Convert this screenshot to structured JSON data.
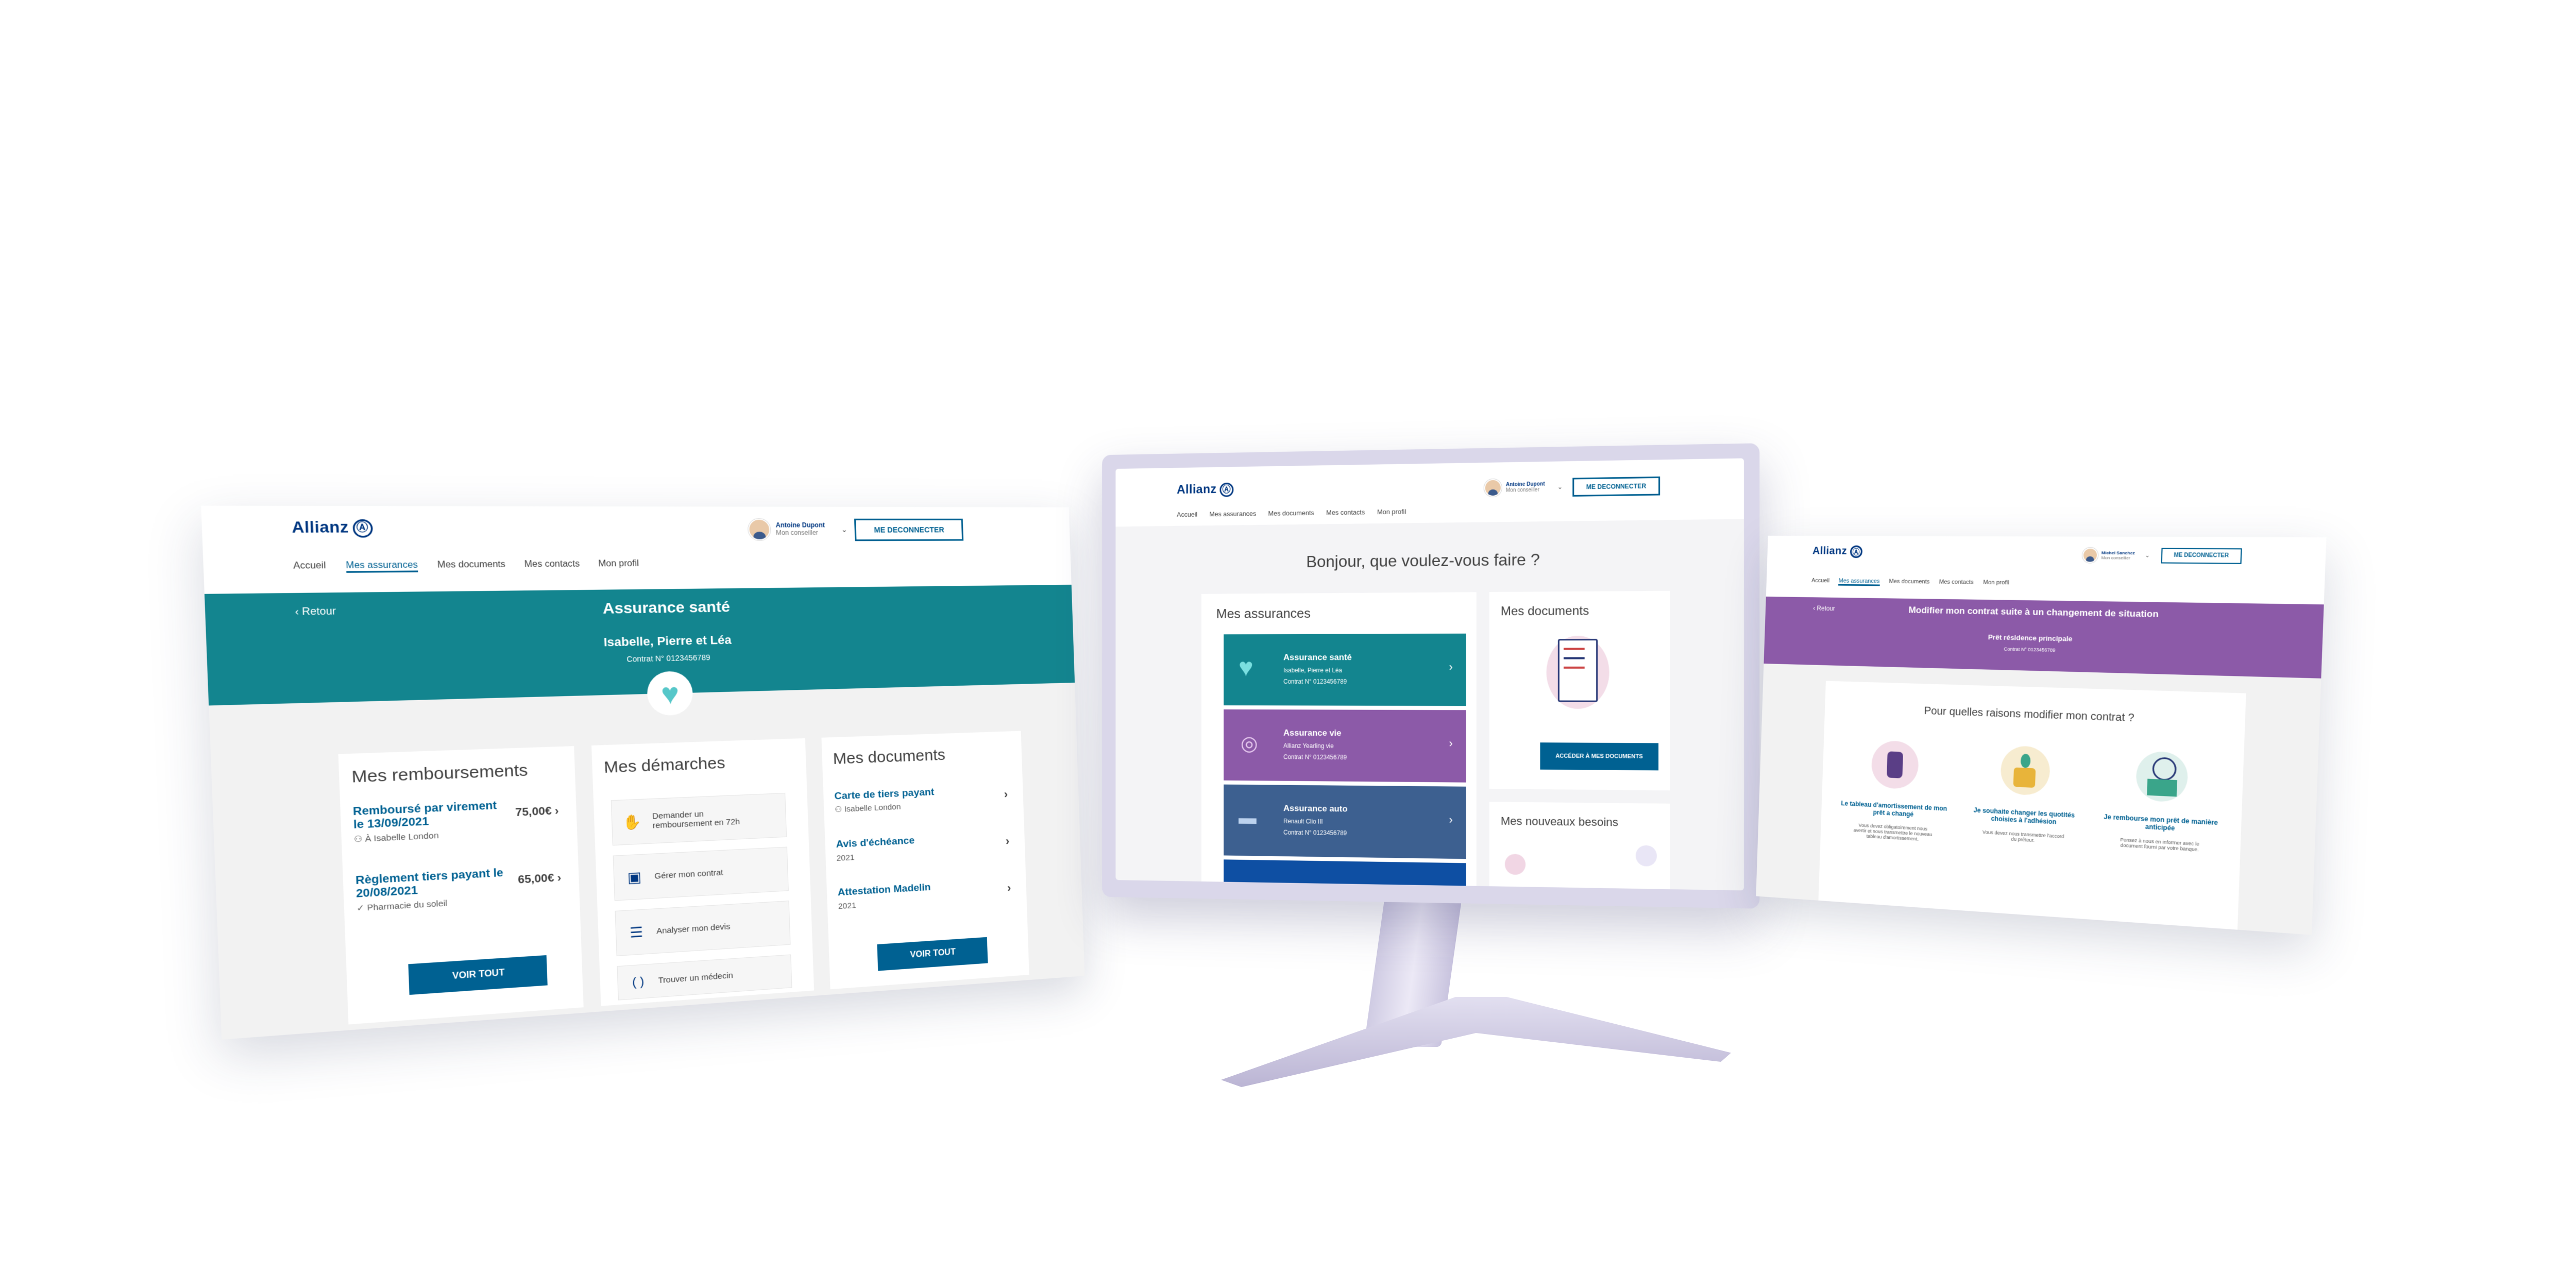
{
  "brand": {
    "logo": "Allianz",
    "logo_mark": "Ⓐ",
    "primary": "#003781",
    "accent": "#006192",
    "teal": "#13858f",
    "purple": "#8c5aa8",
    "auto_blue": "#3d6090"
  },
  "common": {
    "user_name": "Antoine Dupont",
    "user_role": "Mon conseiller",
    "logout": "ME DECONNECTER",
    "nav": [
      "Accueil",
      "Mes assurances",
      "Mes documents",
      "Mes contacts",
      "Mon profil"
    ]
  },
  "left": {
    "back": "Retour",
    "title": "Assurance santé",
    "insured": "Isabelle, Pierre et Léa",
    "contract": "Contrat N° 0123456789",
    "reimbursements": {
      "title": "Mes remboursements",
      "items": [
        {
          "label": "Remboursé par virement le 13/09/2021",
          "who": "À Isabelle London",
          "amount": "75,00€"
        },
        {
          "label": "Règlement tiers payant le 20/08/2021",
          "who": "Pharmacie du soleil",
          "amount": "65,00€"
        }
      ],
      "button": "VOIR TOUT"
    },
    "steps": {
      "title": "Mes démarches",
      "items": [
        "Demander un remboursement en 72h",
        "Gérer mon contrat",
        "Analyser mon devis",
        "Trouver un médecin"
      ]
    },
    "documents": {
      "title": "Mes documents",
      "items": [
        {
          "label": "Carte de tiers payant",
          "sub": "Isabelle London"
        },
        {
          "label": "Avis d'échéance",
          "sub": "2021"
        },
        {
          "label": "Attestation Madelin",
          "sub": "2021"
        }
      ],
      "button": "VOIR TOUT"
    }
  },
  "center": {
    "greeting": "Bonjour, que voulez-vous faire ?",
    "insurances_title": "Mes assurances",
    "insurances": [
      {
        "title": "Assurance santé",
        "sub": "Isabelle, Pierre et Léa",
        "contract": "Contrat N° 0123456789",
        "icon": "heart-icon"
      },
      {
        "title": "Assurance vie",
        "sub": "Allianz Yearling vie",
        "contract": "Contrat N° 0123456789",
        "icon": "coins-icon"
      },
      {
        "title": "Assurance auto",
        "sub": "Renault Clio III",
        "contract": "Contrat N° 0123456789",
        "icon": "car-icon"
      }
    ],
    "documents_title": "Mes documents",
    "documents_button": "ACCÉDER À MES DOCUMENTS",
    "needs_title": "Mes nouveaux besoins"
  },
  "right": {
    "user_name": "Michel Sanchez",
    "back": "Retour",
    "title": "Modifier mon contrat suite à un changement de situation",
    "subtitle": "Prêt résidence principale",
    "contract": "Contrat N° 0123456789",
    "question": "Pour quelles raisons modifier mon contrat ?",
    "reasons": [
      {
        "title": "Le tableau d'amortissement de mon prêt a changé",
        "text": "Vous devez obligatoirement nous avertir et nous transmettre le nouveau tableau d'amortissement."
      },
      {
        "title": "Je souhaite changer les quotités choisies à l'adhésion",
        "text": "Vous devez nous transmettre l'accord du prêteur."
      },
      {
        "title": "Je rembourse mon prêt de manière anticipée",
        "text": "Pensez à nous en informer avec le document fourni par votre banque."
      }
    ]
  }
}
